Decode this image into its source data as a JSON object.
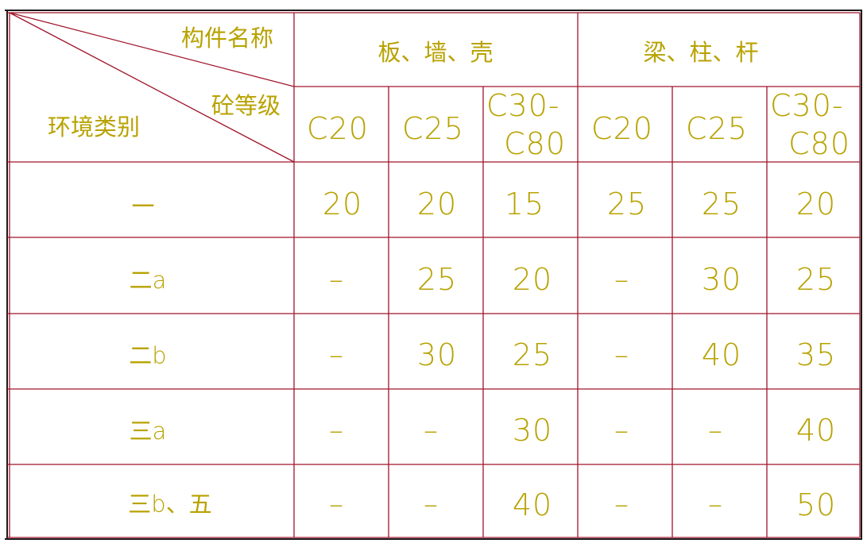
{
  "table": {
    "corner": {
      "component_label": "构件名称",
      "concrete_grade_label": "砼等级",
      "environment_label": "环境类别"
    },
    "groups": [
      {
        "label": "板、墙、壳"
      },
      {
        "label": "梁、柱、杆"
      }
    ],
    "grade_headers": [
      {
        "line1": "C20",
        "line2": ""
      },
      {
        "line1": "C25",
        "line2": ""
      },
      {
        "line1": "C30-",
        "line2": "C80"
      },
      {
        "line1": "C20",
        "line2": ""
      },
      {
        "line1": "C25",
        "line2": ""
      },
      {
        "line1": "C30-",
        "line2": "C80"
      }
    ],
    "rows": [
      {
        "category": "一",
        "values": [
          "20",
          "20",
          "15",
          "25",
          "25",
          "20"
        ]
      },
      {
        "category": "二a",
        "values": [
          "–",
          "25",
          "20",
          "–",
          "30",
          "25"
        ]
      },
      {
        "category": "二b",
        "values": [
          "–",
          "30",
          "25",
          "–",
          "40",
          "35"
        ]
      },
      {
        "category": "三a",
        "values": [
          "–",
          "–",
          "30",
          "–",
          "–",
          "40"
        ]
      },
      {
        "category": "三b、五",
        "values": [
          "–",
          "–",
          "40",
          "–",
          "–",
          "50"
        ]
      }
    ]
  },
  "colors": {
    "grid_line": "#a0142a",
    "text": "#b8a200",
    "frame": "#1a1a1a",
    "background": "#ffffff"
  }
}
